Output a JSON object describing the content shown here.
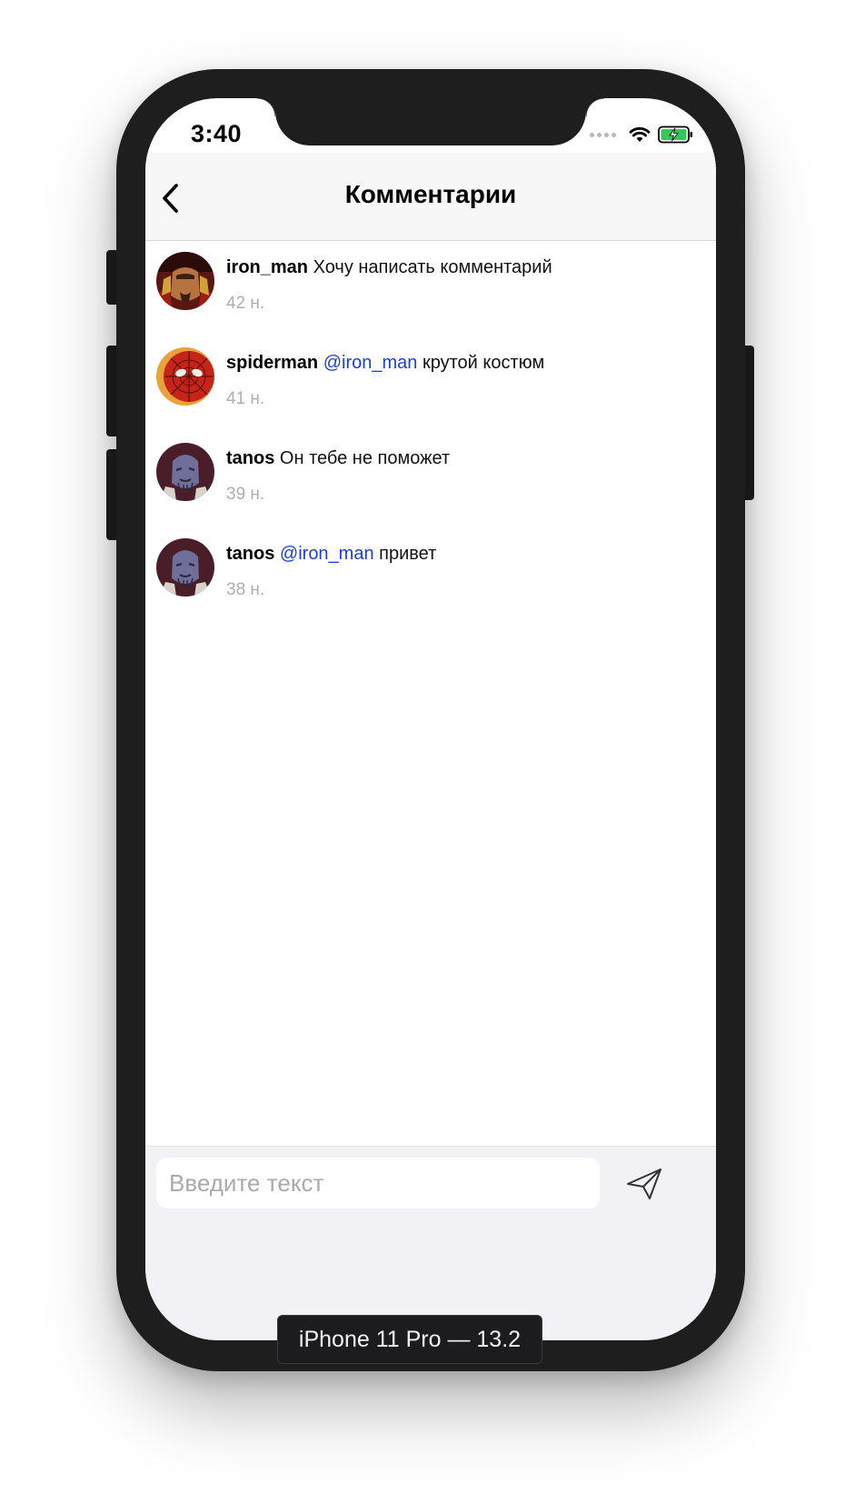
{
  "status_bar": {
    "time": "3:40"
  },
  "nav": {
    "title": "Комментарии"
  },
  "comments": [
    {
      "user": "iron_man",
      "mention": "",
      "text": "Хочу написать комментарий",
      "time": "42 н."
    },
    {
      "user": "spiderman",
      "mention": "@iron_man",
      "text": "крутой костюм",
      "time": "41 н."
    },
    {
      "user": "tanos",
      "mention": "",
      "text": "Он тебе не поможет",
      "time": "39 н."
    },
    {
      "user": "tanos",
      "mention": "@iron_man",
      "text": "привет",
      "time": "38 н."
    }
  ],
  "input": {
    "placeholder": "Введите текст",
    "value": ""
  },
  "device": {
    "label": "iPhone 11 Pro — 13.2"
  },
  "colors": {
    "mention": "#1c3fd8",
    "timestamp": "#aeaeb2",
    "battery": "#34c759"
  },
  "icons": [
    "back-chevron-icon",
    "wifi-icon",
    "battery-charging-icon",
    "send-icon",
    "signal-dots-icon"
  ]
}
